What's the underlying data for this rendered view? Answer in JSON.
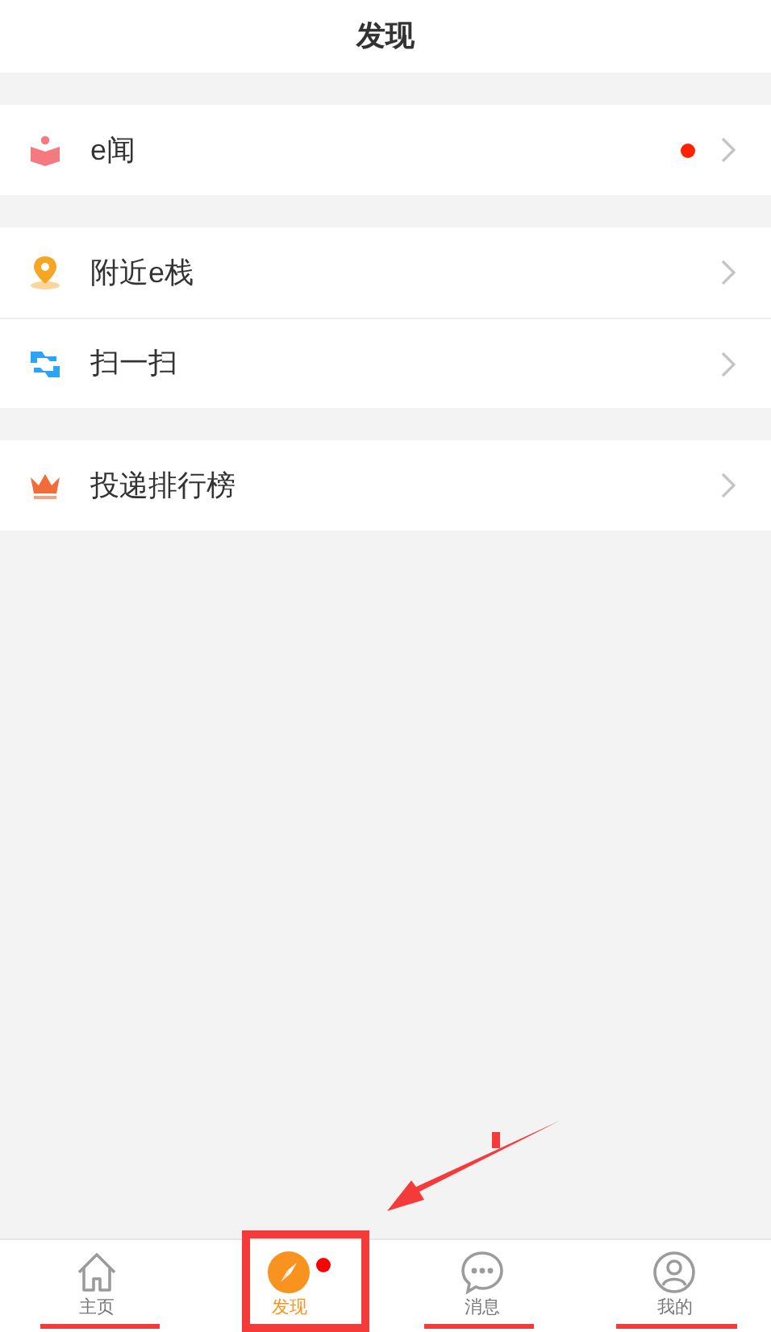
{
  "header": {
    "title": "发现"
  },
  "groups": [
    {
      "items": [
        {
          "kind": "book",
          "label": "e闻",
          "badge": true
        }
      ]
    },
    {
      "items": [
        {
          "kind": "pin",
          "label": "附近e栈",
          "badge": false
        },
        {
          "kind": "scan",
          "label": "扫一扫",
          "badge": false
        }
      ]
    },
    {
      "items": [
        {
          "kind": "crown",
          "label": "投递排行榜",
          "badge": false
        }
      ]
    }
  ],
  "tabs": [
    {
      "kind": "home",
      "label": "主页",
      "selected": false,
      "badge": false
    },
    {
      "kind": "compass",
      "label": "发现",
      "selected": true,
      "badge": true
    },
    {
      "kind": "chat",
      "label": "消息",
      "selected": false,
      "badge": false
    },
    {
      "kind": "person",
      "label": "我的",
      "selected": false,
      "badge": false
    }
  ]
}
